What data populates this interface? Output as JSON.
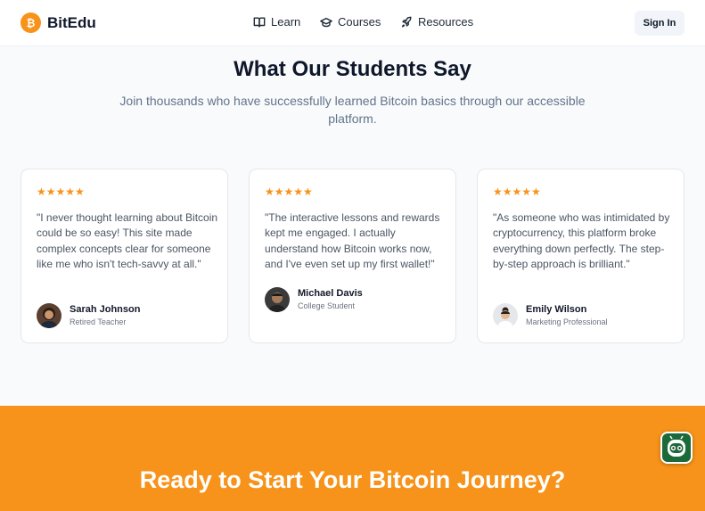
{
  "header": {
    "logo_symbol": "₿",
    "brand": "BitEdu",
    "nav": [
      {
        "label": "Learn",
        "icon": "book-icon"
      },
      {
        "label": "Courses",
        "icon": "graduation-cap-icon"
      },
      {
        "label": "Resources",
        "icon": "rocket-icon"
      }
    ],
    "signin_label": "Sign In"
  },
  "testimonials": {
    "title": "What Our Students Say",
    "subtitle": "Join thousands who have successfully learned Bitcoin basics through our accessible platform.",
    "items": [
      {
        "rating": 5,
        "stars": "★★★★★",
        "quote": "\"I never thought learning about Bitcoin could be so easy! This site made complex concepts clear for someone like me who isn't tech-savvy at all.\"",
        "name": "Sarah Johnson",
        "role": "Retired Teacher"
      },
      {
        "rating": 5,
        "stars": "★★★★★",
        "quote": "\"The interactive lessons and rewards kept me engaged. I actually understand how Bitcoin works now, and I've even set up my first wallet!\"",
        "name": "Michael Davis",
        "role": "College Student"
      },
      {
        "rating": 5,
        "stars": "★★★★★",
        "quote": "\"As someone who was intimidated by cryptocurrency, this platform broke everything down perfectly. The step-by-step approach is brilliant.\"",
        "name": "Emily Wilson",
        "role": "Marketing Professional"
      }
    ]
  },
  "cta": {
    "title": "Ready to Start Your Bitcoin Journey?"
  },
  "colors": {
    "accent": "#f7931a",
    "star": "#f7931a",
    "assistant_button": "#1b6b3a"
  },
  "assistant": {
    "icon": "robot-icon"
  }
}
